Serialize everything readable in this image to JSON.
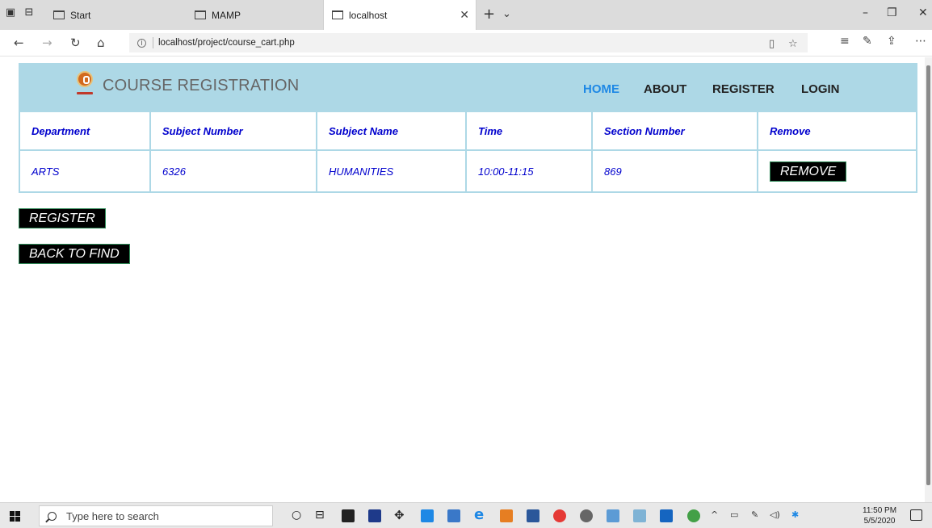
{
  "browser": {
    "tabs": [
      {
        "label": "Start",
        "active": false
      },
      {
        "label": "MAMP",
        "active": false
      },
      {
        "label": "localhost",
        "active": true
      }
    ],
    "url": "localhost/project/course_cart.php"
  },
  "site": {
    "title": "COURSE REGISTRATION",
    "nav": {
      "home": "HOME",
      "about": "ABOUT",
      "register": "REGISTER",
      "login": "LOGIN"
    },
    "accent_color": "#add8e6",
    "link_color": "#1e88e5"
  },
  "cart": {
    "headers": [
      "Department",
      "Subject Number",
      "Subject Name",
      "Time",
      "Section Number",
      "Remove"
    ],
    "rows": [
      {
        "department": "ARTS",
        "subject_number": "6326",
        "subject_name": "HUMANITIES",
        "time": "10:00-11:15",
        "section_number": "869",
        "remove_label": "REMOVE"
      }
    ],
    "text_color": "#0000cd"
  },
  "actions": {
    "register_label": "REGISTER",
    "back_label": "BACK TO FIND"
  },
  "taskbar": {
    "search_placeholder": "Type here to search",
    "time": "11:50 PM",
    "date": "5/5/2020"
  }
}
